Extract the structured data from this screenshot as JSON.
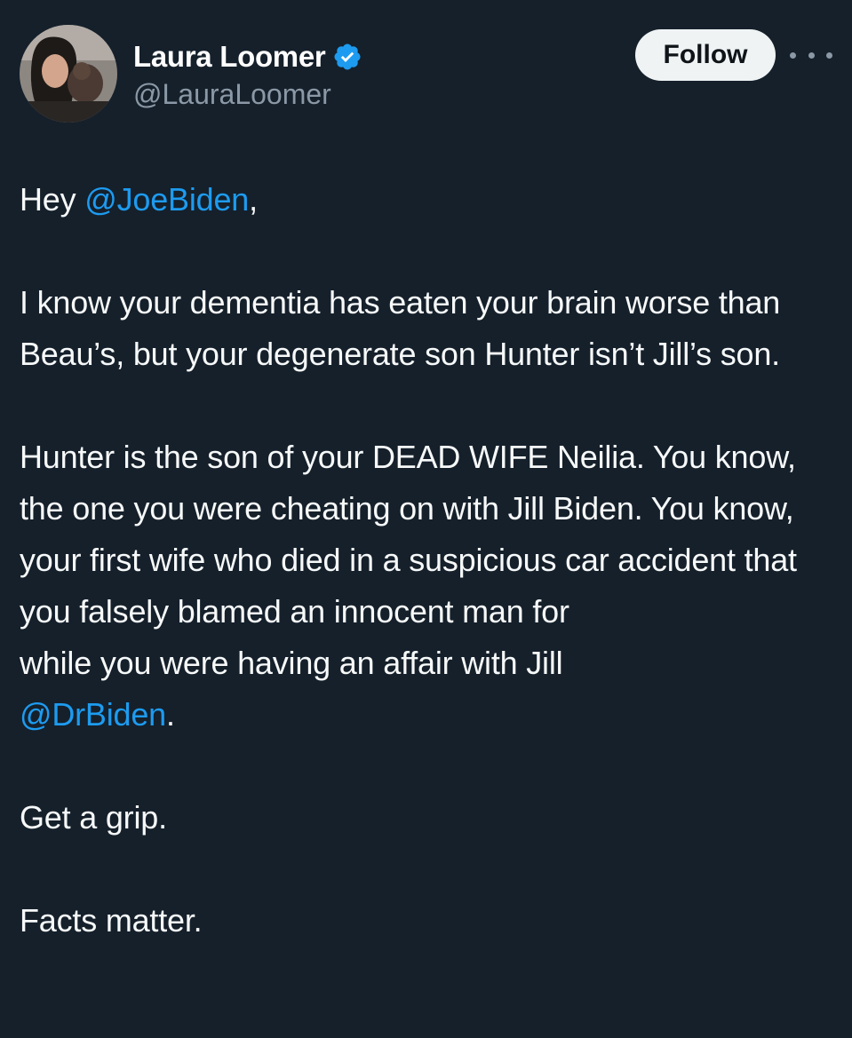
{
  "user": {
    "display_name": "Laura Loomer",
    "handle": "@LauraLoomer",
    "verified_icon": "verified-badge-icon",
    "verified_color": "#1d9bf0"
  },
  "actions": {
    "follow_label": "Follow",
    "more_icon": "more-options-icon"
  },
  "tweet": {
    "p1_prefix": "Hey ",
    "p1_mention": "@JoeBiden",
    "p1_suffix": ",",
    "p2": "I know your dementia has eaten your brain worse than Beau’s, but your degenerate son Hunter isn’t Jill’s son.",
    "p3_line1": "Hunter is the son of your DEAD WIFE Neilia. You know, the one you were cheating on with Jill Biden. You know, your first wife who died in a suspicious car accident that you falsely blamed an innocent man for",
    "p3_line2": "while you were having an affair with Jill",
    "p3_mention": "@DrBiden",
    "p3_suffix": ".",
    "p4": "Get a grip.",
    "p5": "Facts matter."
  },
  "colors": {
    "background": "#15202b",
    "text": "#f7f9f9",
    "secondary_text": "#8b98a5",
    "link": "#1d9bf0",
    "follow_bg": "#eff3f4"
  }
}
